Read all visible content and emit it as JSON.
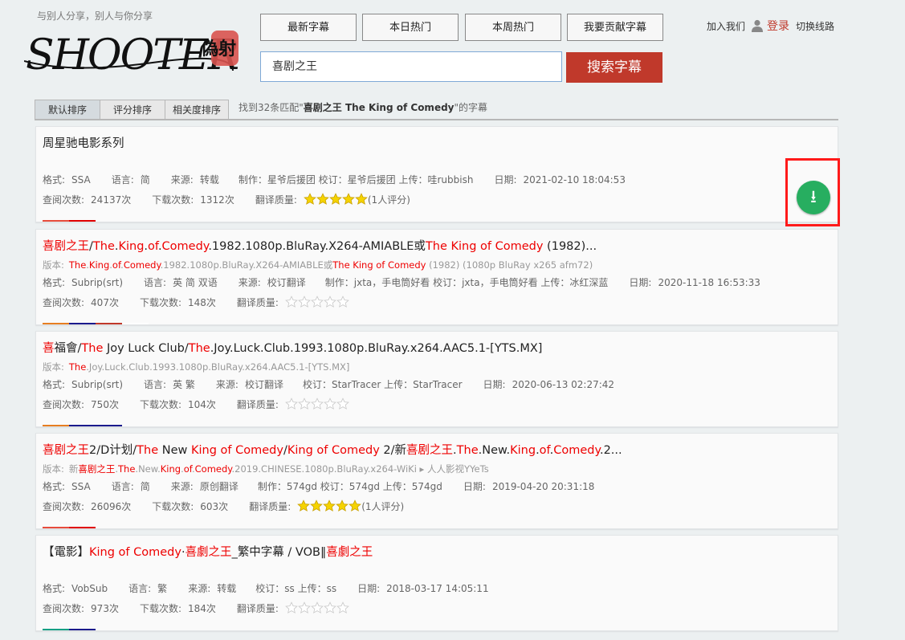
{
  "header": {
    "slogan": "与别人分享，别人与你分享",
    "logo_text": "SHOOTER",
    "logo_seal": "偽射",
    "nav": [
      "最新字幕",
      "本日热门",
      "本周热门",
      "我要贡献字幕"
    ],
    "search_value": "喜剧之王",
    "search_button": "搜索字幕",
    "join": "加入我们",
    "login": "登录",
    "switch": "切换线路",
    "brand_color": "#c0392b"
  },
  "sort": {
    "tabs": [
      "默认排序",
      "评分排序",
      "相关度排序"
    ],
    "found_prefix": "找到32条匹配\"",
    "found_query": "喜剧之王 The King of Comedy",
    "found_suffix": "\"的字幕"
  },
  "labels": {
    "format": "格式:",
    "language": "语言:",
    "source": "来源:",
    "date": "日期:",
    "views": "查阅次数:",
    "downloads": "下载次数:",
    "quality": "翻译质量:",
    "version": "版本:"
  },
  "results": [
    {
      "title": [
        {
          "t": "周星驰电影系列",
          "h": false
        }
      ],
      "version": [],
      "format": "SSA",
      "language": "简",
      "source": "转载",
      "credits": "制作：星爷后援团 校订：星爷后援团 上传：哇rubbish",
      "date": "2021-02-10 18:04:53",
      "views": "24137次",
      "downloads": "1312次",
      "rating": 5,
      "rating_note": "(1人评分)",
      "colors": [
        "#e74c3c",
        "#e00000"
      ]
    },
    {
      "title": [
        {
          "t": "喜剧之王",
          "h": true
        },
        {
          "t": "/",
          "h": false
        },
        {
          "t": "The",
          "h": true
        },
        {
          "t": ".",
          "h": false
        },
        {
          "t": "King",
          "h": true
        },
        {
          "t": ".",
          "h": false
        },
        {
          "t": "of",
          "h": true
        },
        {
          "t": ".",
          "h": false
        },
        {
          "t": "Comedy",
          "h": true
        },
        {
          "t": ".1982.1080p.BluRay.X264-AMIABLE或",
          "h": false
        },
        {
          "t": "The King of Comedy",
          "h": true
        },
        {
          "t": " (1982)...",
          "h": false
        }
      ],
      "version": [
        {
          "t": "The",
          "h": true
        },
        {
          "t": ".",
          "h": false
        },
        {
          "t": "King",
          "h": true
        },
        {
          "t": ".",
          "h": false
        },
        {
          "t": "of",
          "h": true
        },
        {
          "t": ".",
          "h": false
        },
        {
          "t": "Comedy",
          "h": true
        },
        {
          "t": ".1982.1080p.BluRay.X264-AMIABLE或",
          "h": false
        },
        {
          "t": "The King of Comedy",
          "h": true
        },
        {
          "t": " (1982) (1080p BluRay x265 afm72)",
          "h": false
        }
      ],
      "format": "Subrip(srt)",
      "language": "英 简 双语",
      "source": "校订翻译",
      "credits": "制作：jxta，手电筒好看 校订：jxta，手电筒好看 上传：冰红深蓝",
      "date": "2020-11-18 16:53:33",
      "views": "407次",
      "downloads": "148次",
      "rating": 0,
      "rating_note": "",
      "colors": [
        "#e67e22",
        "#1a1a8c",
        "#c0392b",
        "#ffffff"
      ]
    },
    {
      "title": [
        {
          "t": "喜",
          "h": true
        },
        {
          "t": "福會/",
          "h": false
        },
        {
          "t": "The",
          "h": true
        },
        {
          "t": " Joy Luck Club/",
          "h": false
        },
        {
          "t": "The",
          "h": true
        },
        {
          "t": ".Joy.Luck.Club.1993.1080p.BluRay.x264.AAC5.1-[YTS.MX]",
          "h": false
        }
      ],
      "version": [
        {
          "t": "The",
          "h": true
        },
        {
          "t": ".Joy.Luck.Club.1993.1080p.BluRay.x264.AAC5.1-[YTS.MX]",
          "h": false
        }
      ],
      "format": "Subrip(srt)",
      "language": "英 繁",
      "source": "校订翻译",
      "credits": "校订：StarTracer 上传：StarTracer",
      "date": "2020-06-13 02:27:42",
      "views": "750次",
      "downloads": "104次",
      "rating": 0,
      "rating_note": "",
      "colors": [
        "#e67e22",
        "#1a1a8c",
        "#1a1a8c"
      ]
    },
    {
      "title": [
        {
          "t": "喜剧之王",
          "h": true
        },
        {
          "t": "2/D计划/",
          "h": false
        },
        {
          "t": "The",
          "h": true
        },
        {
          "t": " New ",
          "h": false
        },
        {
          "t": "King of Comedy",
          "h": true
        },
        {
          "t": "/",
          "h": false
        },
        {
          "t": "King of Comedy",
          "h": true
        },
        {
          "t": " 2/新",
          "h": false
        },
        {
          "t": "喜剧之王",
          "h": true
        },
        {
          "t": ".",
          "h": false
        },
        {
          "t": "The",
          "h": true
        },
        {
          "t": ".New.",
          "h": false
        },
        {
          "t": "King",
          "h": true
        },
        {
          "t": ".",
          "h": false
        },
        {
          "t": "of",
          "h": true
        },
        {
          "t": ".",
          "h": false
        },
        {
          "t": "Comedy",
          "h": true
        },
        {
          "t": ".2...",
          "h": false
        }
      ],
      "version": [
        {
          "t": "新",
          "h": false
        },
        {
          "t": "喜剧之王",
          "h": true
        },
        {
          "t": ".",
          "h": false
        },
        {
          "t": "The",
          "h": true
        },
        {
          "t": ".New.",
          "h": false
        },
        {
          "t": "King",
          "h": true
        },
        {
          "t": ".",
          "h": false
        },
        {
          "t": "of",
          "h": true
        },
        {
          "t": ".",
          "h": false
        },
        {
          "t": "Comedy",
          "h": true
        },
        {
          "t": ".2019.CHINESE.1080p.BluRay.x264-WiKi  ▸ 人人影视YYeTs",
          "h": false
        }
      ],
      "format": "SSA",
      "language": "简",
      "source": "原创翻译",
      "credits": "制作：574gd 校订：574gd 上传：574gd",
      "date": "2019-04-20 20:31:18",
      "views": "26096次",
      "downloads": "603次",
      "rating": 5,
      "rating_note": "(1人评分)",
      "colors": [
        "#e74c3c",
        "#e00000"
      ]
    },
    {
      "title": [
        {
          "t": "【電影】",
          "h": false
        },
        {
          "t": "King of Comedy",
          "h": true
        },
        {
          "t": "·",
          "h": false
        },
        {
          "t": "喜劇之王",
          "h": true
        },
        {
          "t": "_繁中字幕 / VOB‖",
          "h": false
        },
        {
          "t": "喜劇之王",
          "h": true
        }
      ],
      "version": [],
      "format": "VobSub",
      "language": "繁",
      "source": "转载",
      "credits": "校订：ss 上传：ss",
      "date": "2018-03-17 14:05:11",
      "views": "973次",
      "downloads": "184次",
      "rating": 0,
      "rating_note": "",
      "colors": [
        "#16a085",
        "#1a1a8c"
      ]
    }
  ],
  "download_icon": "download-arrow-icon",
  "download_color": "#27ae60",
  "highlight_color": "#ff1a1a"
}
